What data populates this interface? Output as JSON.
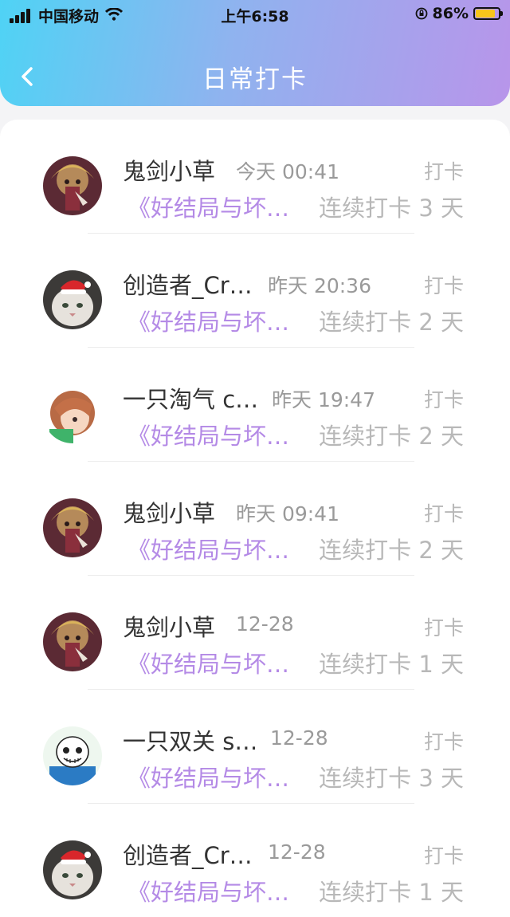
{
  "status_bar": {
    "carrier": "中国移动",
    "time": "上午6:58",
    "battery": "86%",
    "battery_level": 0.86,
    "icons": [
      "signal-icon",
      "wifi-icon",
      "orientation-lock-icon",
      "battery-icon"
    ]
  },
  "header": {
    "title": "日常打卡",
    "back_icon": "chevron-left-icon"
  },
  "colors": {
    "header_gradient": [
      "#4fd3f5",
      "#8fb3ef",
      "#b895ea"
    ],
    "book_text": "#b48ae6",
    "muted": "#b8b8b8"
  },
  "entries": [
    {
      "name": "鬼剑小草",
      "time": "今天 00:41",
      "action": "打卡",
      "book": "《好结局与坏…",
      "streak": "连续打卡 3 天",
      "avatar": "anime-character-avatar"
    },
    {
      "name": "创造者_Cr…",
      "time": "昨天 20:36",
      "action": "打卡",
      "book": "《好结局与坏…",
      "streak": "连续打卡 2 天",
      "avatar": "cat-santa-hat-avatar"
    },
    {
      "name": "一只淘气 c…",
      "time": "昨天 19:47",
      "action": "打卡",
      "book": "《好结局与坏…",
      "streak": "连续打卡 2 天",
      "avatar": "anime-girl-avatar"
    },
    {
      "name": "鬼剑小草",
      "time": "昨天 09:41",
      "action": "打卡",
      "book": "《好结局与坏…",
      "streak": "连续打卡 2 天",
      "avatar": "anime-character-avatar"
    },
    {
      "name": "鬼剑小草",
      "time": "12-28",
      "action": "打卡",
      "book": "《好结局与坏…",
      "streak": "连续打卡 1 天",
      "avatar": "anime-character-avatar"
    },
    {
      "name": "一只双关 s…",
      "time": "12-28",
      "action": "打卡",
      "book": "《好结局与坏…",
      "streak": "连续打卡 3 天",
      "avatar": "skeleton-avatar"
    },
    {
      "name": "创造者_Cr…",
      "time": "12-28",
      "action": "打卡",
      "book": "《好结局与坏…",
      "streak": "连续打卡 1 天",
      "avatar": "cat-santa-hat-avatar"
    }
  ]
}
